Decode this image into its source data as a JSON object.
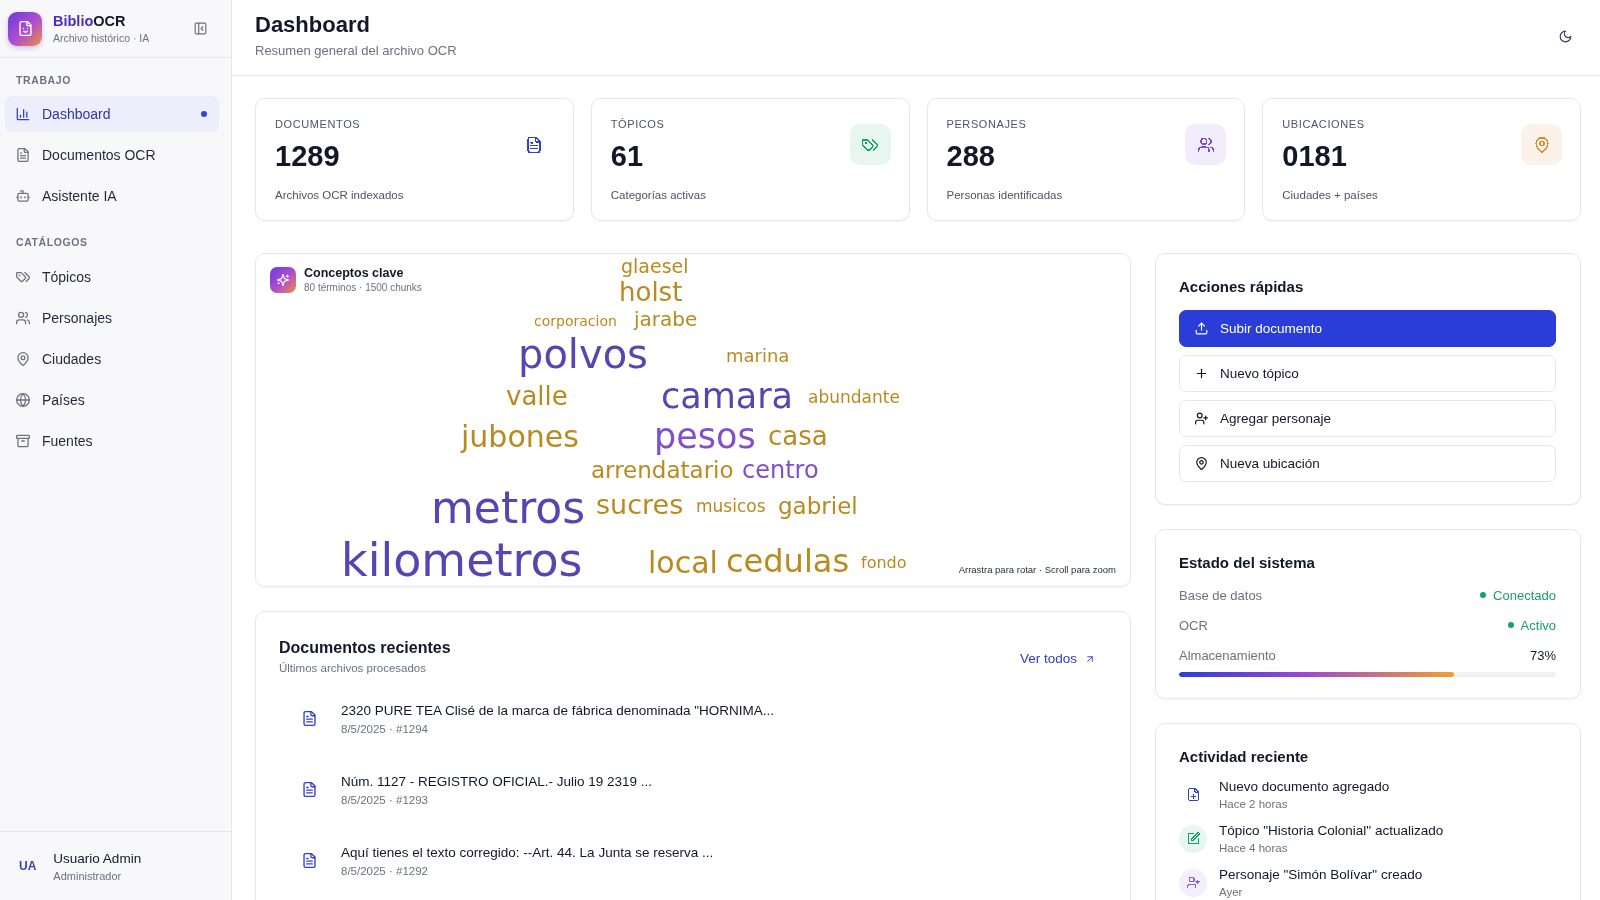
{
  "sidebar": {
    "brand": {
      "name_accent": "Biblio",
      "name_rest": "OCR",
      "subtitle": "Archivo histórico · IA"
    },
    "sections": [
      {
        "label": "TRABAJO",
        "items": [
          {
            "label": "Dashboard",
            "kind": "dashboard",
            "selected": true
          },
          {
            "label": "Documentos OCR",
            "kind": "documents",
            "selected": false
          },
          {
            "label": "Asistente IA",
            "kind": "assistant",
            "selected": false
          }
        ]
      },
      {
        "label": "CATÁLOGOS",
        "items": [
          {
            "label": "Tópicos",
            "kind": "topics",
            "selected": false
          },
          {
            "label": "Personajes",
            "kind": "people",
            "selected": false
          },
          {
            "label": "Ciudades",
            "kind": "cities",
            "selected": false
          },
          {
            "label": "Países",
            "kind": "countries",
            "selected": false
          },
          {
            "label": "Fuentes",
            "kind": "sources",
            "selected": false
          }
        ]
      }
    ],
    "user": {
      "initials": "UA",
      "name": "Usuario Admin",
      "role": "Administrador"
    }
  },
  "header": {
    "title": "Dashboard",
    "subtitle": "Resumen general del archivo OCR"
  },
  "stats": [
    {
      "label": "DOCUMENTOS",
      "value": "1289",
      "caption": "Archivos OCR indexados",
      "kind": "documents",
      "color": "#3340c8",
      "tinted": false
    },
    {
      "label": "TÓPICOS",
      "value": "61",
      "caption": "Categorías activas",
      "kind": "topics",
      "color": "#17a06a",
      "tinted": true
    },
    {
      "label": "PERSONAJES",
      "value": "288",
      "caption": "Personas identificadas",
      "kind": "people",
      "color": "#7c4ddb",
      "tinted": true
    },
    {
      "label": "UBICACIONES",
      "value": "0181",
      "caption": "Ciudades + países",
      "kind": "places",
      "color": "#d98a2b",
      "tinted": true
    }
  ],
  "concept_cloud": {
    "title": "Conceptos clave",
    "subtitle": "80 términos · 1500 chunks",
    "hint": "Arrastra para rotar · Scroll para zoom",
    "words": [
      {
        "text": "glaesel",
        "color": "#b98a1f"
      },
      {
        "text": "holst",
        "color": "#b98a1f"
      },
      {
        "text": "corporacion",
        "color": "#b98a1f"
      },
      {
        "text": "jarabe",
        "color": "#b98a1f"
      },
      {
        "text": "polvos",
        "color": "#5845b1"
      },
      {
        "text": "marina",
        "color": "#b98a1f"
      },
      {
        "text": "valle",
        "color": "#b98a1f"
      },
      {
        "text": "camara",
        "color": "#5845b1"
      },
      {
        "text": "abundante",
        "color": "#b98a1f"
      },
      {
        "text": "jubones",
        "color": "#b98a1f"
      },
      {
        "text": "pesos",
        "color": "#8150c9"
      },
      {
        "text": "casa",
        "color": "#b98a1f"
      },
      {
        "text": "arrendatario",
        "color": "#b98a1f"
      },
      {
        "text": "centro",
        "color": "#8150c9"
      },
      {
        "text": "metros",
        "color": "#5845b1"
      },
      {
        "text": "sucres",
        "color": "#b98a1f"
      },
      {
        "text": "musicos",
        "color": "#b98a1f"
      },
      {
        "text": "gabriel",
        "color": "#b98a1f"
      },
      {
        "text": "kilometros",
        "color": "#5845b1"
      },
      {
        "text": "local",
        "color": "#b98a1f"
      },
      {
        "text": "cedulas",
        "color": "#b98a1f"
      },
      {
        "text": "fondo",
        "color": "#b98a1f"
      }
    ]
  },
  "recent_documents": {
    "title": "Documentos recientes",
    "subtitle": "Últimos archivos procesados",
    "link": "Ver todos",
    "items": [
      {
        "title": "2320 PURE TEA Clisé de la marca de fábrica denominada \"HORNIMA...",
        "meta": "8/5/2025 · #1294"
      },
      {
        "title": "Núm. 1127 - REGISTRO OFICIAL.- Julio 19 2319 ...",
        "meta": "8/5/2025 · #1293"
      },
      {
        "title": "Aquí tienes el texto corregido: --Art. 44. La Junta se reserva ...",
        "meta": "8/5/2025 · #1292"
      }
    ]
  },
  "quick_actions": {
    "title": "Acciones rápidas",
    "buttons": [
      {
        "label": "Subir documento",
        "kind": "upload",
        "primary": true
      },
      {
        "label": "Nuevo tópico",
        "kind": "topic",
        "primary": false
      },
      {
        "label": "Agregar personaje",
        "kind": "person",
        "primary": false
      },
      {
        "label": "Nueva ubicación",
        "kind": "location",
        "primary": false
      }
    ]
  },
  "system_status": {
    "title": "Estado del sistema",
    "rows": [
      {
        "label": "Base de datos",
        "value": "Conectado",
        "kind": "status",
        "online": true
      },
      {
        "label": "OCR",
        "value": "Activo",
        "kind": "status",
        "online": true
      },
      {
        "label": "Almacenamiento",
        "value": "73%",
        "kind": "meter",
        "level": 0.73
      }
    ]
  },
  "activity": {
    "title": "Actividad reciente",
    "items": [
      {
        "text": "Nuevo documento agregado",
        "time": "Hace 2 horas",
        "kind": "document",
        "color": "#3340c8",
        "tinted": false
      },
      {
        "text": "Tópico \"Historia Colonial\" actualizado",
        "time": "Hace 4 horas",
        "kind": "edit",
        "color": "#17a06a",
        "tinted": true
      },
      {
        "text": "Personaje \"Simón Bolívar\" creado",
        "time": "Ayer",
        "kind": "person",
        "color": "#8b5cf6",
        "tinted": true
      }
    ]
  }
}
